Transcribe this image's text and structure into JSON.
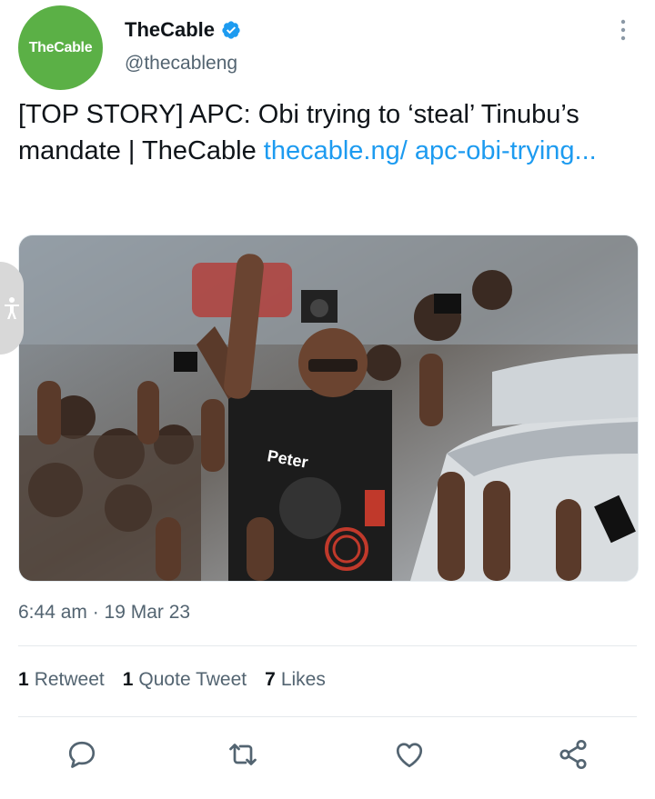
{
  "account": {
    "avatar_text": "TheCable",
    "display_name": "TheCable",
    "handle": "@thecableng",
    "verified_icon": "verified-badge-icon",
    "brand_color": "#5bb046"
  },
  "tweet": {
    "text": "[TOP STORY] APC: Obi trying to ‘steal’ Tinubu’s mandate | TheCable ",
    "link_text": "thecable.ng/ apc-obi-trying...",
    "link_color": "#1d9bf0"
  },
  "meta": {
    "timestamp": "6:44 am · 19 Mar 23"
  },
  "stats": {
    "retweets_count": "1",
    "retweets_label": "Retweet",
    "quotes_count": "1",
    "quotes_label": "Quote Tweet",
    "likes_count": "7",
    "likes_label": "Likes"
  },
  "actions": {
    "reply_icon": "reply-icon",
    "retweet_icon": "retweet-icon",
    "like_icon": "like-icon",
    "share_icon": "share-icon"
  }
}
